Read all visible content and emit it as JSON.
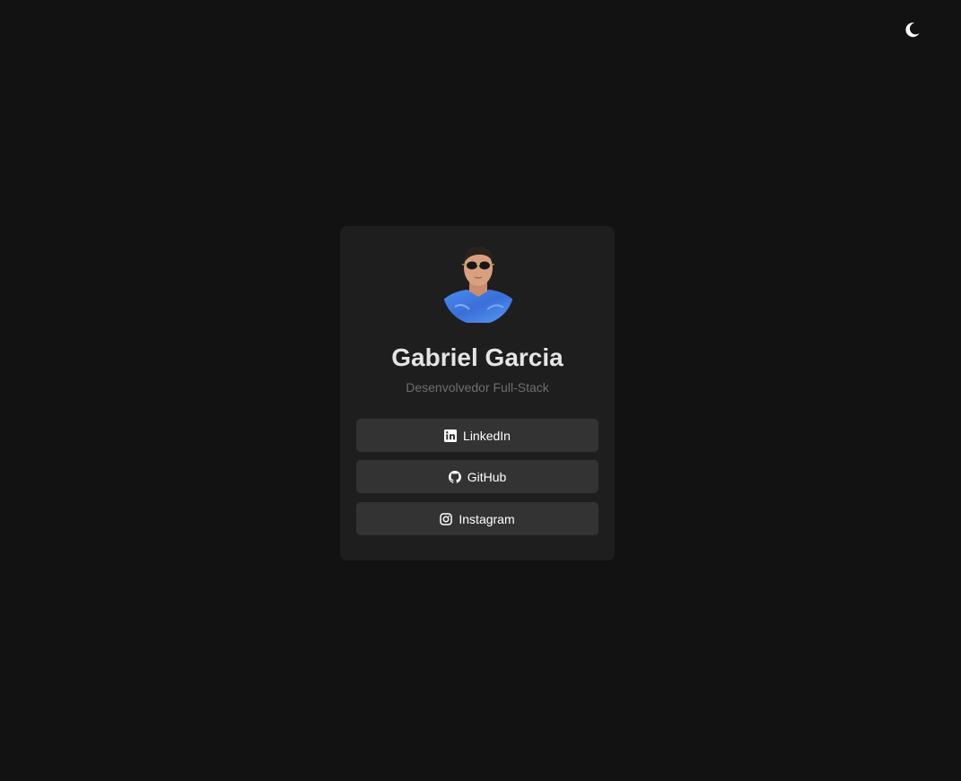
{
  "header": {
    "theme_toggle_icon": "moon-icon"
  },
  "profile": {
    "name": "Gabriel Garcia",
    "role": "Desenvolvedor Full-Stack",
    "avatar_icon": "avatar"
  },
  "links": [
    {
      "label": "LinkedIn",
      "icon": "linkedin-icon"
    },
    {
      "label": "GitHub",
      "icon": "github-icon"
    },
    {
      "label": "Instagram",
      "icon": "instagram-icon"
    }
  ],
  "colors": {
    "background": "#121212",
    "card": "#1e1e1e",
    "button": "#333333",
    "name_text": "#e4e4e4",
    "role_text": "#6e6e6e",
    "button_text": "#ffffff",
    "avatar_shirt": "#3b7de6"
  }
}
